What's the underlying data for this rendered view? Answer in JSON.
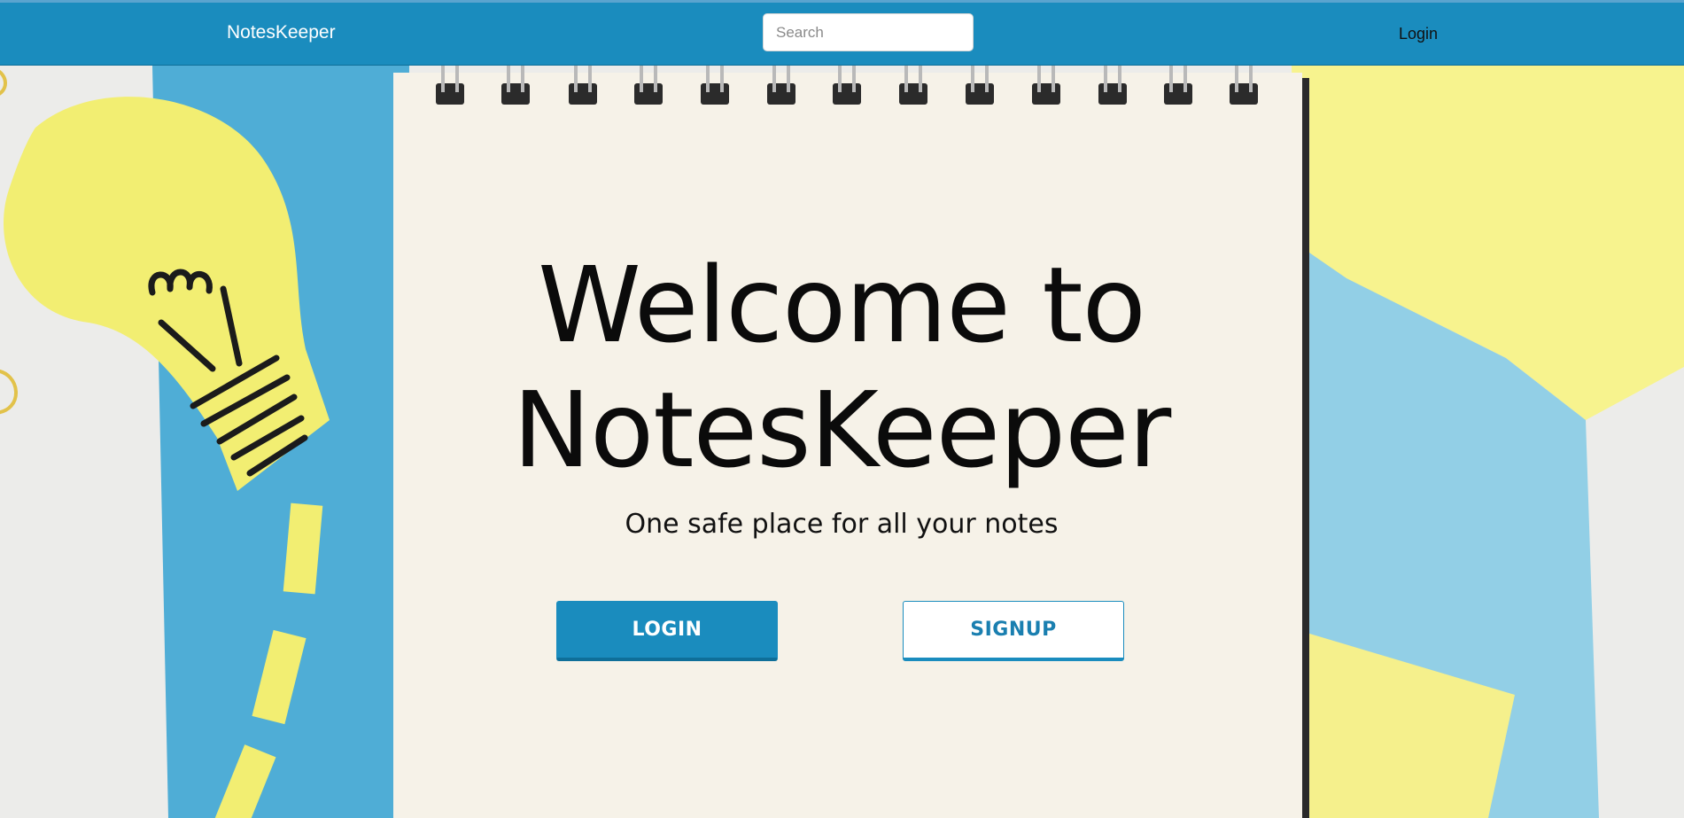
{
  "navbar": {
    "brand": "NotesKeeper",
    "search_placeholder": "Search",
    "login_link": "Login"
  },
  "hero": {
    "headline_line1": "Welcome to",
    "headline_line2": "NotesKeeper",
    "tagline": "One safe place for all your notes",
    "login_button": "LOGIN",
    "signup_button": "SIGNUP"
  },
  "colors": {
    "primary": "#1a8cbe",
    "primary_dark": "#0f6f99",
    "paper": "#f6f2e8",
    "accent_yellow": "#f3ef7a",
    "accent_blue": "#4fadd6"
  },
  "icons": {
    "background": "notebook-lightbulb-illustration"
  }
}
